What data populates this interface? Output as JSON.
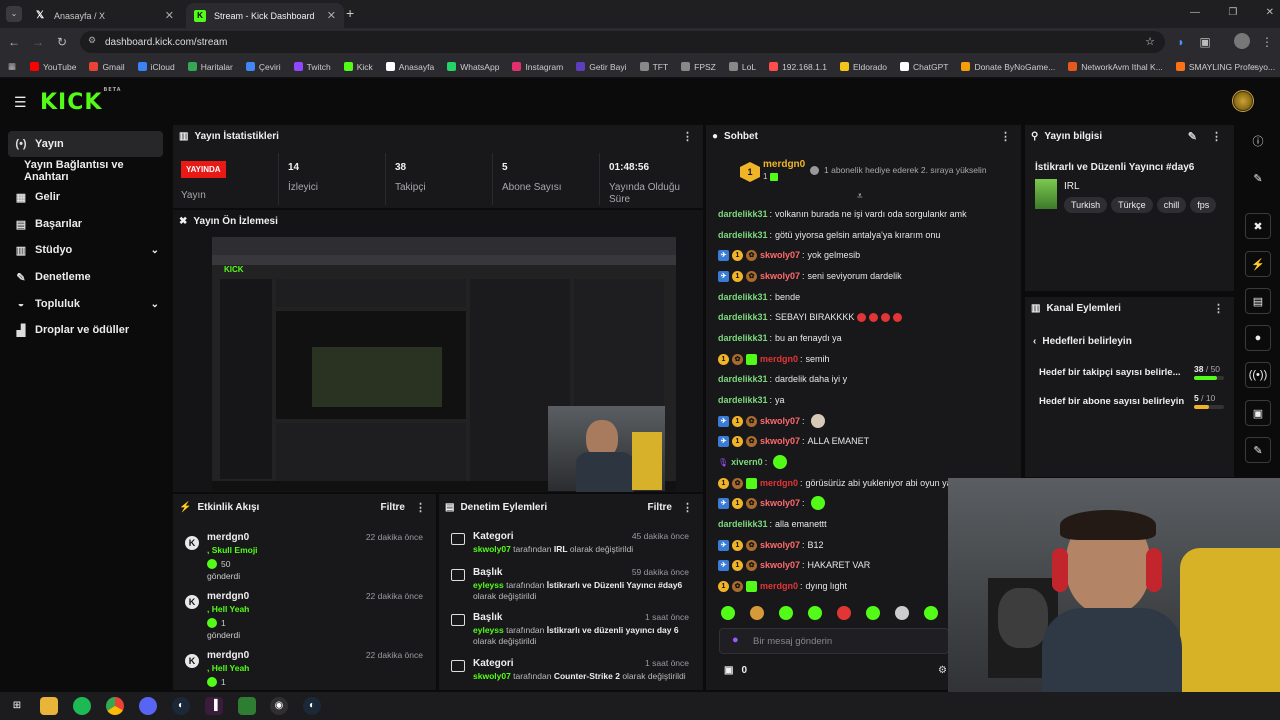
{
  "browser": {
    "tabs": [
      {
        "title": "Anasayfa / X",
        "active": false
      },
      {
        "title": "Stream - Kick Dashboard",
        "active": true
      }
    ],
    "new_tab": "+",
    "url": "dashboard.kick.com/stream",
    "bookmarks": [
      "YouTube",
      "Gmail",
      "iCloud",
      "Haritalar",
      "Çeviri",
      "Twitch",
      "Kick",
      "Anasayfa",
      "WhatsApp",
      "Instagram",
      "Getir Bayi",
      "TFT",
      "FPSZ",
      "LoL",
      "192.168.1.1",
      "Eldorado",
      "ChatGPT",
      "Donate ByNoGame...",
      "NetworkAvm Ithal K...",
      "SMAYLING Profesyo..."
    ],
    "bookmark_colors": [
      "#ff0000",
      "#ea4335",
      "#3b82f6",
      "#34a853",
      "#4285f4",
      "#9146ff",
      "#53fc18",
      "#ffffff",
      "#25d366",
      "#e1306c",
      "#5d3ebc",
      "#888888",
      "#888888",
      "#888888",
      "#ff4d4d",
      "#f5c518",
      "#ffffff",
      "#f59e0b",
      "#e55a1c",
      "#f97316"
    ]
  },
  "header": {
    "logo": "KICK",
    "logo_sup": "BETA"
  },
  "sidebar": {
    "items": [
      {
        "label": "Yayın",
        "icon": "broadcast-icon",
        "glyph": "(•)",
        "active": true,
        "chevron": false
      },
      {
        "label": "Yayın Bağlantısı ve Anahtarı",
        "icon": "",
        "glyph": "",
        "active": false,
        "chevron": false
      },
      {
        "label": "Gelir",
        "icon": "revenue-icon",
        "glyph": "▦",
        "active": false,
        "chevron": false
      },
      {
        "label": "Başarılar",
        "icon": "achievements-icon",
        "glyph": "▤",
        "active": false,
        "chevron": false
      },
      {
        "label": "Stüdyo",
        "icon": "studio-icon",
        "glyph": "▥",
        "active": false,
        "chevron": true
      },
      {
        "label": "Denetleme",
        "icon": "wrench-icon",
        "glyph": "✎",
        "active": false,
        "chevron": false
      },
      {
        "label": "Topluluk",
        "icon": "community-icon",
        "glyph": "◒",
        "active": false,
        "chevron": true
      },
      {
        "label": "Droplar ve ödüller",
        "icon": "drops-icon",
        "glyph": "▟",
        "active": false,
        "chevron": false
      }
    ]
  },
  "stats": {
    "title": "Yayın İstatistikleri",
    "live_badge": "YAYINDA",
    "live_label": "Yayın",
    "items": [
      {
        "value": "14",
        "label": "İzleyici"
      },
      {
        "value": "38",
        "label": "Takipçi"
      },
      {
        "value": "5",
        "label": "Abone Sayısı"
      },
      {
        "value": "01:48:56",
        "label": "Yayında Olduğu Süre"
      }
    ]
  },
  "preview": {
    "title": "Yayın Ön İzlemesi"
  },
  "activity": {
    "title": "Etkinlik Akışı",
    "filter": "Filtre",
    "items": [
      {
        "user": "merdgn0",
        "event": ", Skull Emoji",
        "count": "50",
        "action": "gönderdi",
        "time": "22 dakika önce"
      },
      {
        "user": "merdgn0",
        "event": ", Hell Yeah",
        "count": "1",
        "action": "gönderdi",
        "time": "22 dakika önce"
      },
      {
        "user": "merdgn0",
        "event": ", Hell Yeah",
        "count": "1",
        "action": "",
        "time": "22 dakika önce"
      }
    ]
  },
  "moderation": {
    "title": "Denetim Eylemleri",
    "filter": "Filtre",
    "items": [
      {
        "title": "Kategori",
        "time": "45 dakika önce",
        "user": "skwoly07",
        "mid": " tarafından ",
        "value": "IRL",
        "tail": " olarak değiştirildi",
        "tail2": ""
      },
      {
        "title": "Başlık",
        "time": "59 dakika önce",
        "user": "eyleyss",
        "mid": " tarafından ",
        "value": "İstikrarlı ve Düzenli Yayıncı #day6",
        "tail": "",
        "tail2": "olarak değiştirildi"
      },
      {
        "title": "Başlık",
        "time": "1 saat önce",
        "user": "eyleyss",
        "mid": " tarafından ",
        "value": "İstikrarlı ve düzenli yayıncı day 6",
        "tail": "",
        "tail2": "olarak değiştirildi"
      },
      {
        "title": "Kategori",
        "time": "1 saat önce",
        "user": "skwoly07",
        "mid": " tarafından ",
        "value": "Counter-Strike 2",
        "tail": " olarak değiştirildi",
        "tail2": ""
      }
    ]
  },
  "chat": {
    "title": "Sohbet",
    "pinned": {
      "user": "merdgn0",
      "count": "1",
      "text": "1 abonelik hediye ederek 2. sıraya yükselin"
    },
    "messages": [
      {
        "user": "dardelikk31",
        "color": "#7dd87d",
        "badges": [],
        "text": "volkanın burada ne işi vardı oda sorgulankr amk"
      },
      {
        "user": "dardelikk31",
        "color": "#7dd87d",
        "badges": [],
        "text": "götü yiyorsa gelsin antalya'ya kırarım onu"
      },
      {
        "user": "skwoly07",
        "color": "#ff6b6b",
        "badges": [
          "vip",
          "sub",
          "gift"
        ],
        "text": "yok gelmesib"
      },
      {
        "user": "skwoly07",
        "color": "#ff6b6b",
        "badges": [
          "vip",
          "sub",
          "gift"
        ],
        "text": "seni seviyorum dardelik"
      },
      {
        "user": "dardelikk31",
        "color": "#7dd87d",
        "badges": [],
        "text": "bende"
      },
      {
        "user": "dardelikk31",
        "color": "#7dd87d",
        "badges": [],
        "text": "SEBAYI BIRAKKKK"
      },
      {
        "user": "dardelikk31",
        "color": "#7dd87d",
        "badges": [],
        "text": "bu an fenaydı ya"
      },
      {
        "user": "merdgn0",
        "color": "#e23535",
        "badges": [
          "sub",
          "gift",
          "mod"
        ],
        "text": "semih"
      },
      {
        "user": "dardelikk31",
        "color": "#7dd87d",
        "badges": [],
        "text": "dardelik daha iyi y"
      },
      {
        "user": "dardelikk31",
        "color": "#7dd87d",
        "badges": [],
        "text": "ya"
      },
      {
        "user": "skwoly07",
        "color": "#ff6b6b",
        "badges": [
          "vip",
          "sub",
          "gift"
        ],
        "text": ""
      },
      {
        "user": "skwoly07",
        "color": "#ff6b6b",
        "badges": [
          "vip",
          "sub",
          "gift"
        ],
        "text": "ALLA EMANET"
      },
      {
        "user": "xivern0",
        "color": "#7dd87d",
        "badges": [
          "mic"
        ],
        "text": ""
      },
      {
        "user": "merdgn0",
        "color": "#e23535",
        "badges": [
          "sub",
          "gift",
          "mod"
        ],
        "text": "görüsürüz abi yukleniyor abi oyun yarın kasa m"
      },
      {
        "user": "skwoly07",
        "color": "#ff6b6b",
        "badges": [
          "vip",
          "sub",
          "gift"
        ],
        "text": ""
      },
      {
        "user": "dardelikk31",
        "color": "#7dd87d",
        "badges": [],
        "text": "alla emanettt"
      },
      {
        "user": "skwoly07",
        "color": "#ff6b6b",
        "badges": [
          "vip",
          "sub",
          "gift"
        ],
        "text": "B12"
      },
      {
        "user": "skwoly07",
        "color": "#ff6b6b",
        "badges": [
          "vip",
          "sub",
          "gift"
        ],
        "text": "HAKARET VAR"
      },
      {
        "user": "merdgn0",
        "color": "#e23535",
        "badges": [
          "sub",
          "gift",
          "mod"
        ],
        "text": "dyıng lıght"
      }
    ],
    "input_placeholder": "Bir mesaj gönderin",
    "points": "0"
  },
  "stream_info": {
    "title": "Yayın bilgisi",
    "stream_title": "İstikrarlı ve Düzenli Yayıncı #day6",
    "category": "IRL",
    "tags": [
      "Turkish",
      "Türkçe",
      "chill",
      "fps"
    ]
  },
  "channel_actions": {
    "title": "Kanal Eylemleri",
    "back_label": "Hedefleri belirleyin",
    "goals": [
      {
        "label": "Hedef bir takipçi sayısı belirle...",
        "current": "38",
        "target": "50",
        "progress": 0.76,
        "color": "#53fc18"
      },
      {
        "label": "Hedef bir abone sayısı belirleyin",
        "current": "5",
        "target": "10",
        "progress": 0.5,
        "color": "#f0b429"
      }
    ]
  }
}
